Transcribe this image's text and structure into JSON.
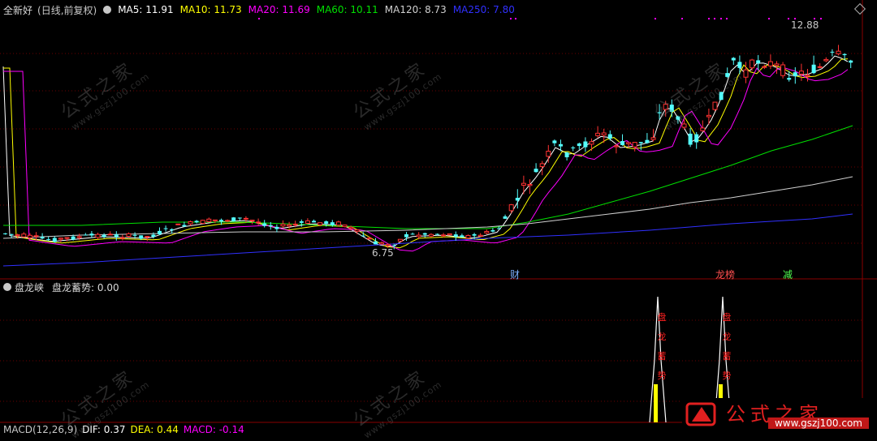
{
  "main_legend": {
    "title": "全新好",
    "mode": "(日线,前复权)",
    "ma": [
      {
        "label": "MA5: 11.91",
        "color": "#ffffff"
      },
      {
        "label": "MA10: 11.73",
        "color": "#ffff00"
      },
      {
        "label": "MA20: 11.69",
        "color": "#ff00ff"
      },
      {
        "label": "MA60: 10.11",
        "color": "#00e000"
      },
      {
        "label": "MA120: 8.73",
        "color": "#d0d0d0"
      },
      {
        "label": "MA250: 7.80",
        "color": "#3030ff"
      }
    ]
  },
  "price_annotations": {
    "high": "12.88",
    "low": "6.75",
    "marker_cai": "财",
    "marker_bang": "龙榜",
    "marker_jian": "减"
  },
  "sub_legend": {
    "name": "盘龙峡",
    "value_label": "盘龙蓄势: 0.00"
  },
  "signal_text": [
    "盘",
    "龙",
    "蓄",
    "势"
  ],
  "macd_legend": {
    "name": "MACD(12,26,9)",
    "dif": "DIF: 0.37",
    "dea": "DEA: 0.44",
    "macd": "MACD: -0.14"
  },
  "watermark": {
    "brand": "公式之家",
    "url": "www.gszj100.com"
  },
  "colors": {
    "up": "#ff3232",
    "down": "#54ffff",
    "grid": "#7a0000",
    "bg": "#000000"
  }
}
